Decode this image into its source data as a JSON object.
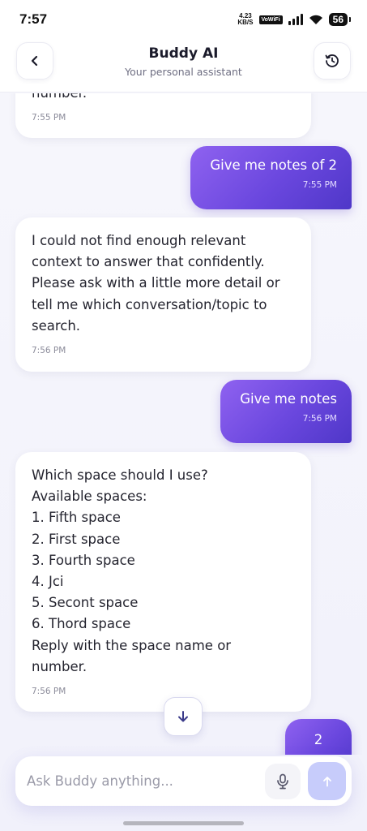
{
  "status_bar": {
    "time": "7:57",
    "net_speed_value": "4.23",
    "net_speed_unit": "KB/S",
    "vowifi": "VoWiFi",
    "battery": "56"
  },
  "header": {
    "title": "Buddy AI",
    "subtitle": "Your personal assistant",
    "back_icon": "chevron-left-icon",
    "history_icon": "history-clock-icon"
  },
  "messages": [
    {
      "role": "assistant",
      "lines": [
        "number."
      ],
      "time": "7:55 PM"
    },
    {
      "role": "user",
      "lines": [
        "Give me notes of 2"
      ],
      "time": "7:55 PM"
    },
    {
      "role": "assistant",
      "lines": [
        "I could not find enough relevant",
        "context to answer that confidently.",
        "Please ask with a little more detail or",
        "tell me which conversation/topic to",
        "search."
      ],
      "time": "7:56 PM"
    },
    {
      "role": "user",
      "lines": [
        "Give me notes"
      ],
      "time": "7:56 PM"
    },
    {
      "role": "assistant",
      "lines": [
        "Which space should I use?",
        "Available spaces:",
        "1. Fifth space",
        "2. First space",
        "3. Fourth space",
        "4. Jci",
        "5. Secont space",
        "6. Thord space",
        "Reply with the space name or",
        "number."
      ],
      "time": "7:56 PM"
    },
    {
      "role": "user",
      "lines": [
        "2"
      ],
      "time": ""
    }
  ],
  "composer": {
    "placeholder": "Ask Buddy anything...",
    "mic_icon": "microphone-icon",
    "send_icon": "arrow-up-icon"
  },
  "scroll_down_icon": "arrow-down-icon",
  "colors": {
    "user_bubble": "#6a47de",
    "accent": "#5b46d6",
    "send_button": "#c7ccfb"
  }
}
